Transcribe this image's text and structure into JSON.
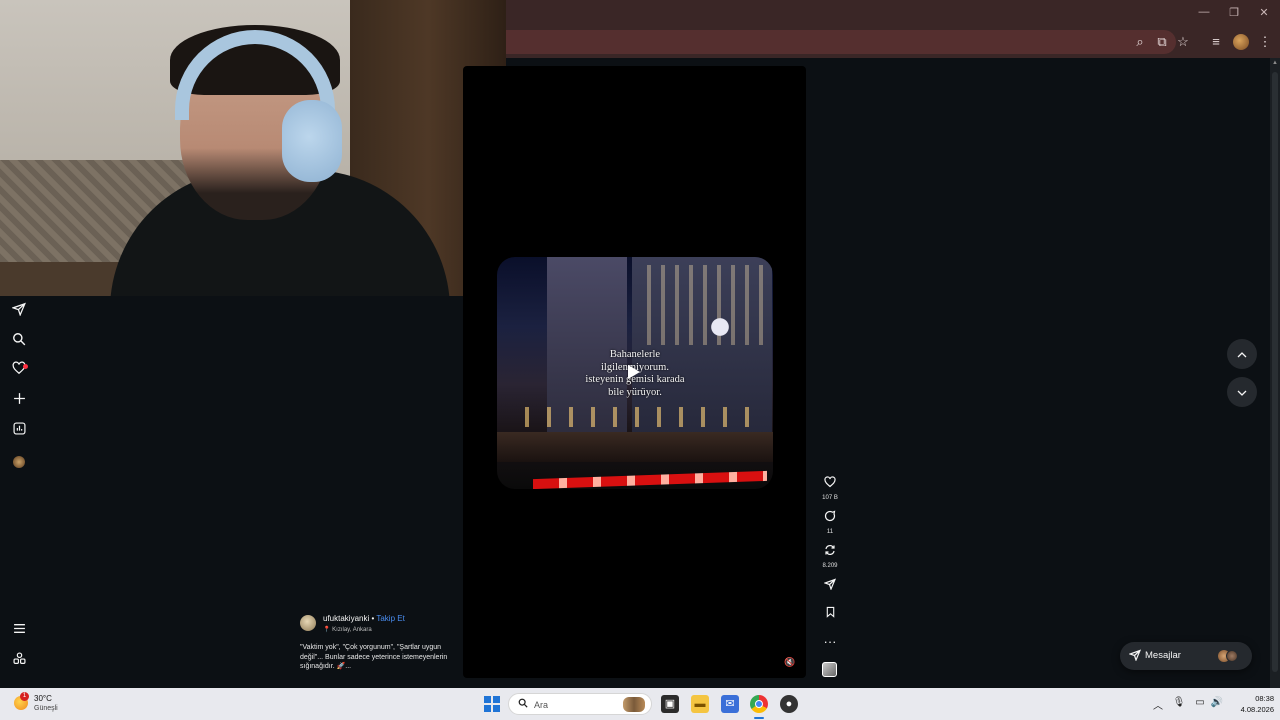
{
  "browser": {
    "window_controls": [
      "—",
      "❐",
      "✕"
    ],
    "toolbar_icons": [
      "zoom-icon",
      "install-icon",
      "star-icon",
      "media-icon",
      "profile-icon",
      "menu-icon"
    ]
  },
  "reel": {
    "overlay_text": "Bahanelerle\nilgilenmiyorum.\nisteyenin gemisi karada\nbile yürüyor.",
    "author": {
      "username": "ufuktakiyanki",
      "separator": " • ",
      "follow_label": "Takip Et",
      "location": "Kızılay, Ankara"
    },
    "caption": "\"Vaktim yok\", \"Çok yorgunum\", \"Şartlar uygun değil\"... Bunlar sadece yeterince istemeyenlerin sığınağıdır. 🚀...",
    "actions": {
      "likes": "107 B",
      "comments": "11",
      "reposts": "8.209"
    }
  },
  "messages": {
    "label": "Mesajlar"
  },
  "taskbar": {
    "weather": {
      "badge": "1",
      "temperature": "30°C",
      "description": "Güneşli"
    },
    "search_label": "Ara",
    "clock": {
      "time": "08:38",
      "date": "4.08.2026"
    }
  },
  "colors": {
    "background": "#0c1014",
    "chrome": "#3a2626",
    "link": "#4a8df0",
    "notification": "#ff3040",
    "taskbar": "#e8e9ee"
  }
}
